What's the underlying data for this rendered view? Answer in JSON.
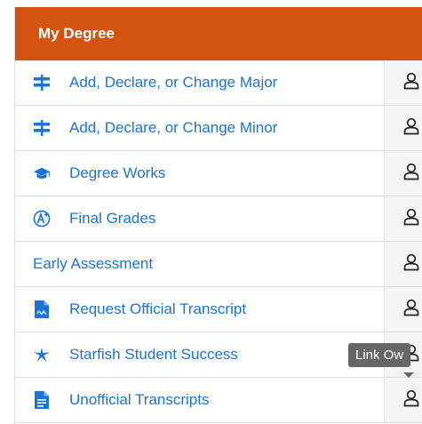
{
  "header": {
    "title": "My Degree"
  },
  "colors": {
    "header_bg": "#d35410",
    "link": "#1a73d9",
    "owner_cell_bg": "#f4f4f4"
  },
  "items": [
    {
      "label": "Add, Declare, or Change Major",
      "icon": "signpost-icon"
    },
    {
      "label": "Add, Declare, or Change Minor",
      "icon": "signpost-icon"
    },
    {
      "label": "Degree Works",
      "icon": "graduation-cap-icon"
    },
    {
      "label": "Final Grades",
      "icon": "circle-a-plus-icon"
    },
    {
      "label": "Early Assessment",
      "icon": ""
    },
    {
      "label": "Request Official Transcript",
      "icon": "document-signature-icon"
    },
    {
      "label": "Starfish Student Success",
      "icon": "starfish-icon"
    },
    {
      "label": "Unofficial Transcripts",
      "icon": "document-icon"
    }
  ],
  "owner_icon": "user-icon",
  "tooltip": {
    "text": "Link Ow"
  }
}
